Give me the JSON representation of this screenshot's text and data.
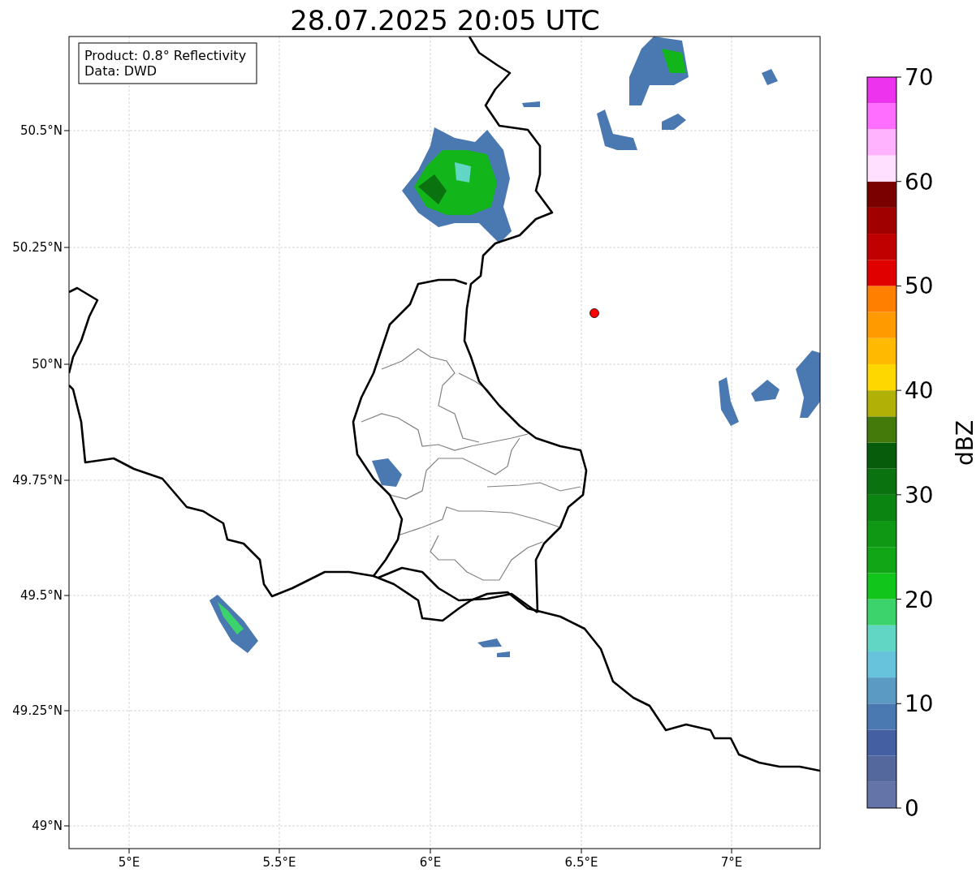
{
  "title": "28.07.2025 20:05 UTC",
  "info_box": [
    "Product: 0.8° Reflectivity",
    "Data: DWD"
  ],
  "map": {
    "xticks": [
      "5°E",
      "5.5°E",
      "6°E",
      "6.5°E",
      "7°E"
    ],
    "yticks": [
      "50.5°N",
      "50.25°N",
      "50°N",
      "49.75°N",
      "49.5°N",
      "49.25°N",
      "49°N"
    ]
  },
  "colorbar": {
    "label": "dBZ",
    "ticks": [
      "70",
      "60",
      "50",
      "40",
      "30",
      "20",
      "10",
      "0"
    ],
    "bins": [
      {
        "color": "#6474a8"
      },
      {
        "color": "#55689e"
      },
      {
        "color": "#4460a3"
      },
      {
        "color": "#4a78b0"
      },
      {
        "color": "#5a9ac3"
      },
      {
        "color": "#67c3dc"
      },
      {
        "color": "#62d6c4"
      },
      {
        "color": "#3dd36c"
      },
      {
        "color": "#12c51a"
      },
      {
        "color": "#10a615"
      },
      {
        "color": "#0e9813"
      },
      {
        "color": "#0c8412"
      },
      {
        "color": "#0a7310"
      },
      {
        "color": "#075c0b"
      },
      {
        "color": "#447a0a"
      },
      {
        "color": "#b0b007"
      },
      {
        "color": "#ffd700"
      },
      {
        "color": "#ffba00"
      },
      {
        "color": "#ff9a00"
      },
      {
        "color": "#ff7f00"
      },
      {
        "color": "#e00000"
      },
      {
        "color": "#c00000"
      },
      {
        "color": "#a00000"
      },
      {
        "color": "#7a0000"
      },
      {
        "color": "#ffe0ff"
      },
      {
        "color": "#ffb3ff"
      },
      {
        "color": "#ff6eff"
      },
      {
        "color": "#ee33ee"
      }
    ]
  }
}
